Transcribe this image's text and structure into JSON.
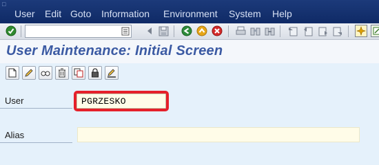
{
  "menu": {
    "items": [
      "User",
      "Edit",
      "Goto",
      "Information",
      "Environment",
      "System",
      "Help"
    ]
  },
  "toolbar": {
    "command_field_value": "",
    "icons": [
      "enter-icon",
      "back-icon",
      "save-icon",
      "back-green-icon",
      "exit-icon",
      "cancel-icon",
      "print-icon",
      "find-icon",
      "find-next-icon",
      "first-page-icon",
      "previous-page-icon",
      "next-page-icon",
      "last-page-icon",
      "create-session-icon",
      "shortcut-icon"
    ]
  },
  "header": {
    "title": "User Maintenance: Initial Screen"
  },
  "app_toolbar": {
    "icons": [
      "create-icon",
      "change-icon",
      "display-icon",
      "delete-icon",
      "copy-icon",
      "lock-unlock-icon",
      "change-password-icon"
    ]
  },
  "form": {
    "user_label": "User",
    "user_value": "PGRZESKO",
    "alias_label": "Alias",
    "alias_value": ""
  },
  "colors": {
    "menubar": "#0f2a66",
    "title": "#3b5aa3",
    "highlight": "#e5202a",
    "input_bg": "#fffce8"
  }
}
